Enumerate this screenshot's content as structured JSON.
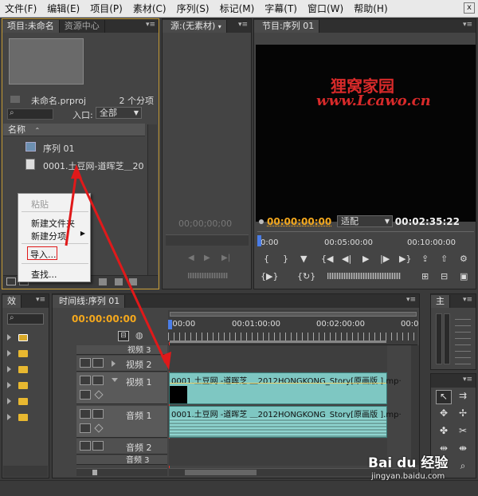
{
  "menubar": {
    "items": [
      "文件(F)",
      "编辑(E)",
      "项目(P)",
      "素材(C)",
      "序列(S)",
      "标记(M)",
      "字幕(T)",
      "窗口(W)",
      "帮助(H)"
    ],
    "close": "x"
  },
  "project_panel": {
    "tab_project": "项目:未命名",
    "tab_resource": "资源中心",
    "filename": "未命名.prproj",
    "item_count": "2 个分项",
    "entry_label": "入口:",
    "entry_value": "全部",
    "column_name": "名称",
    "items": [
      {
        "label": "序列 01",
        "icon": "sequence-icon"
      },
      {
        "label": "0001.土豆网-道晖芝＿20",
        "icon": "video-clip-icon"
      }
    ]
  },
  "context_menu": {
    "items": [
      "粘贴",
      "新建文件夹",
      "新建分项",
      "导入...",
      "查找..."
    ],
    "disabled": [
      true,
      false,
      false,
      false,
      false
    ]
  },
  "source_monitor": {
    "tab": "源:(无素材)",
    "timecode": "00;00;00;00"
  },
  "program_monitor": {
    "tab": "节目:序列 01",
    "watermark_title": "狸窝家园",
    "watermark_url": "www.Lcawo.cn",
    "timecode_current": "00:00:00:00",
    "fit_select": "适配",
    "timecode_total": "00:02:35:22",
    "ruler": [
      "0:00",
      "00:05:00:00",
      "00:10:00:00"
    ]
  },
  "effects_panel": {
    "tab": "效"
  },
  "timeline": {
    "tab": "时间线:序列 01",
    "timecode": "00:00:00:00",
    "ruler": [
      ":00:00",
      "00:01:00:00",
      "00:02:00:00",
      "00:0"
    ],
    "tracks": {
      "video3": "视频 3",
      "video2": "视频 2",
      "video1": "视频 1",
      "audio1": "音频 1",
      "audio2": "音频 2",
      "audio3": "音频 3"
    },
    "clip_video": "0001.土豆网 -道晖芝 ＿2012HONGKONG_Story[原画版 ].mp·",
    "clip_audio": "0001.土豆网 -道晖芝 ＿2012HONGKONG_Story[原画版 ].mp·"
  },
  "tools_panel": {
    "tab": "主"
  },
  "watermark": {
    "brand": "Bai du 经验",
    "url": "jingyan.baidu.com"
  },
  "colors": {
    "accent_orange": "#f4a81d",
    "annotation_red": "#e0191a",
    "clip_teal": "#7ec7c2"
  }
}
